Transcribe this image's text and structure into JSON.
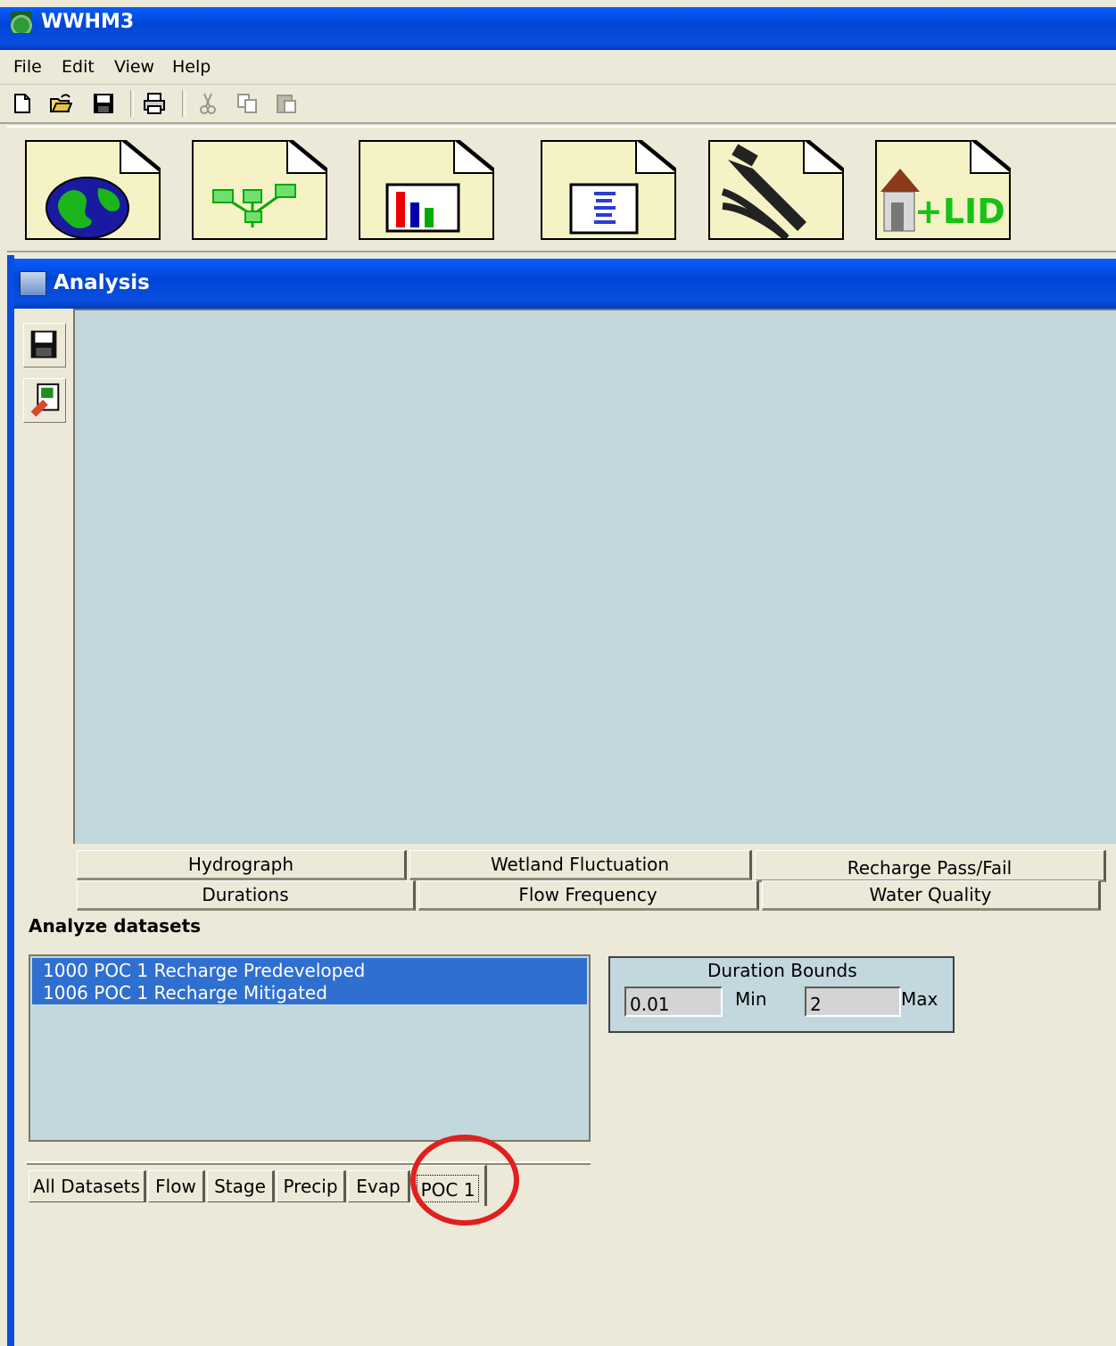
{
  "app": {
    "title": "WWHM3"
  },
  "menu": {
    "items": [
      "File",
      "Edit",
      "View",
      "Help"
    ]
  },
  "toolbar": {
    "icons": [
      "new-file-icon",
      "open-folder-icon",
      "save-icon",
      "print-icon",
      "cut-icon",
      "copy-icon",
      "paste-icon"
    ]
  },
  "launcher": {
    "buttons": [
      "map-icon",
      "schematic-icon",
      "analysis-chart-icon",
      "report-icon",
      "tools-icon",
      "lid-icon"
    ],
    "lid_text": "+LID"
  },
  "analysis": {
    "title": "Analysis",
    "side_buttons": [
      "save-icon",
      "export-excel-icon"
    ],
    "tabs_row1": [
      "Hydrograph",
      "Wetland Fluctuation",
      "Recharge Pass/Fail"
    ],
    "tabs_row2": [
      "Durations",
      "Flow Frequency",
      "Water Quality"
    ]
  },
  "datasets": {
    "heading": "Analyze datasets",
    "items": [
      "1000 POC 1 Recharge Predeveloped",
      "1006 POC 1 Recharge Mitigated"
    ],
    "tabs": [
      "All Datasets",
      "Flow",
      "Stage",
      "Precip",
      "Evap",
      "POC 1"
    ],
    "active_tab": "POC 1"
  },
  "duration_bounds": {
    "title": "Duration Bounds",
    "min_value": "0.01",
    "min_label": "Min",
    "max_value": "2",
    "max_label": "Max"
  },
  "colors": {
    "title_blue": "#0a4ee0",
    "panel_bg": "#ece9d8",
    "graph_bg": "#c3d7de",
    "selection": "#2f6fd0",
    "highlight_red": "#e21f1f"
  }
}
